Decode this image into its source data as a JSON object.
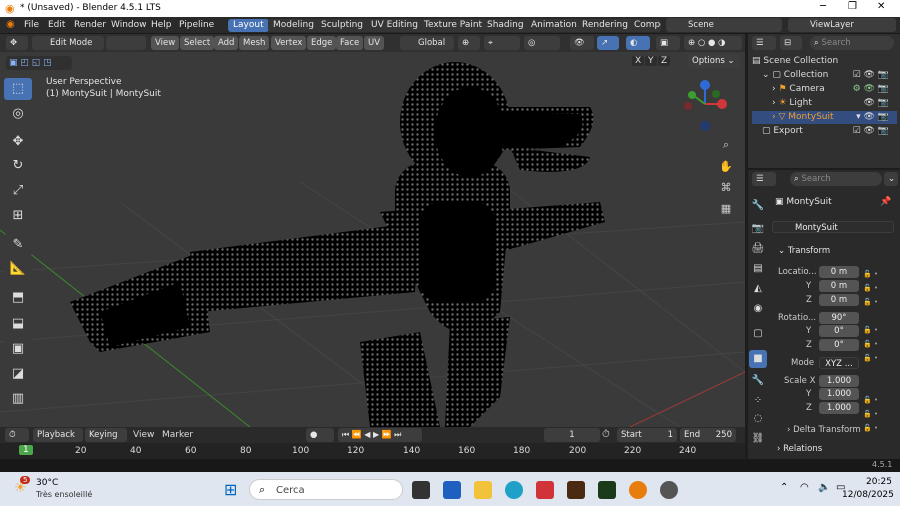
{
  "window": {
    "title": "* (Unsaved) - Blender 4.5.1 LTS"
  },
  "menus": [
    "File",
    "Edit",
    "Render",
    "Window",
    "Help",
    "Pipeline"
  ],
  "workspaces": [
    "Layout",
    "Modeling",
    "Sculpting",
    "UV Editing",
    "Texture Paint",
    "Shading",
    "Animation",
    "Rendering",
    "Compo"
  ],
  "scene": "Scene",
  "view_layer": "ViewLayer",
  "header": {
    "mode": "Edit Mode",
    "menus": [
      "View",
      "Select",
      "Add",
      "Mesh",
      "Vertex",
      "Edge",
      "Face",
      "UV"
    ],
    "orientation": "Global",
    "options": "Options",
    "search": "Search"
  },
  "viewport": {
    "line1": "User Perspective",
    "line2": "(1) MontySuit | MontySuit",
    "axes": [
      "X",
      "Y",
      "Z"
    ]
  },
  "outliner": {
    "title": "Scene Collection",
    "items": [
      "Collection",
      "Camera",
      "Light",
      "MontySuit",
      "Export"
    ]
  },
  "properties": {
    "search": "Search",
    "object_name": "MontySuit",
    "mesh_name": "MontySuit",
    "panel": "Transform",
    "location_label": "Locatio...",
    "location": [
      "0 m",
      "0 m",
      "0 m"
    ],
    "rotation_label": "Rotatio...",
    "rotation": [
      "90°",
      "0°",
      "0°"
    ],
    "mode_label": "Mode",
    "mode": "XYZ ...",
    "scale_label": "Scale X",
    "scale": [
      "1.000",
      "1.000",
      "1.000"
    ],
    "y_label": "Y",
    "z_label": "Z",
    "delta": "Delta Transform",
    "relations": "Relations"
  },
  "timeline": {
    "playback": "Playback",
    "keying": "Keying",
    "view": "View",
    "marker": "Marker",
    "frame": "1",
    "start_label": "Start",
    "start": "1",
    "end_label": "End",
    "end": "250",
    "ticks": [
      "1",
      "20",
      "40",
      "60",
      "80",
      "100",
      "120",
      "140",
      "160",
      "180",
      "200",
      "220",
      "240"
    ]
  },
  "status": {
    "version": "4.5.1"
  },
  "taskbar": {
    "weather_temp": "30°C",
    "weather_desc": "Très ensoleillé",
    "badge": "5",
    "search": "Cerca",
    "time": "20:25",
    "date": "12/08/2025"
  }
}
